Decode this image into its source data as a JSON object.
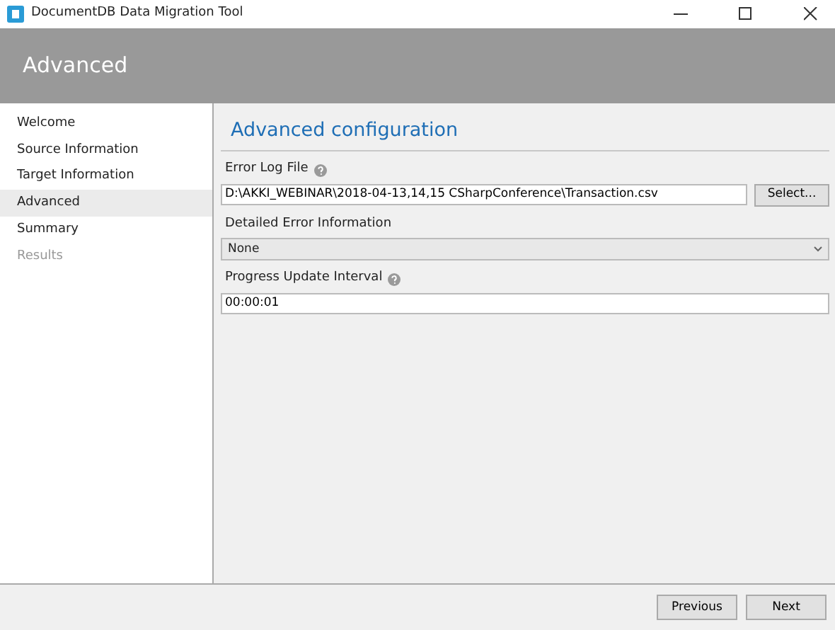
{
  "window": {
    "title": "DocumentDB Data Migration Tool"
  },
  "header": {
    "title": "Advanced"
  },
  "sidebar": {
    "items": [
      {
        "label": "Welcome",
        "selected": false,
        "disabled": false
      },
      {
        "label": "Source Information",
        "selected": false,
        "disabled": false
      },
      {
        "label": "Target Information",
        "selected": false,
        "disabled": false
      },
      {
        "label": "Advanced",
        "selected": true,
        "disabled": false
      },
      {
        "label": "Summary",
        "selected": false,
        "disabled": false
      },
      {
        "label": "Results",
        "selected": false,
        "disabled": true
      }
    ]
  },
  "content": {
    "title": "Advanced configuration",
    "fields": [
      {
        "kind": "file",
        "label": "Error Log File",
        "help": true,
        "value": "D:\\AKKI_WEBINAR\\2018-04-13,14,15 CSharpConference\\Transaction.csv",
        "button": "Select..."
      },
      {
        "kind": "select",
        "label": "Detailed Error Information",
        "help": false,
        "value": "None"
      },
      {
        "kind": "text",
        "label": "Progress Update Interval",
        "help": true,
        "value": "00:00:01"
      }
    ]
  },
  "footer": {
    "buttons": [
      "Previous",
      "Next"
    ]
  }
}
